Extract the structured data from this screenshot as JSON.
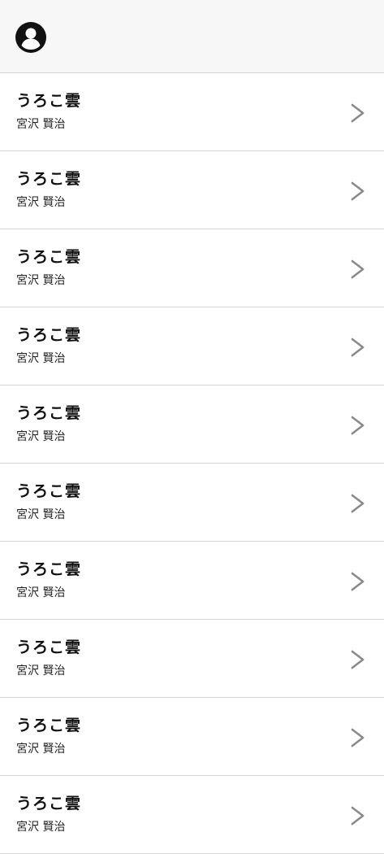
{
  "header": {
    "avatar_icon": "account-circle-icon",
    "colors": {
      "background": "#f7f7f7",
      "icon": "#111111"
    }
  },
  "list": {
    "chevron_icon": "chevron-right-icon",
    "chevron_color": "#8a8a8a",
    "divider_color": "#d6d6d6",
    "items": [
      {
        "title": "うろこ雲",
        "author": "宮沢 賢治"
      },
      {
        "title": "うろこ雲",
        "author": "宮沢 賢治"
      },
      {
        "title": "うろこ雲",
        "author": "宮沢 賢治"
      },
      {
        "title": "うろこ雲",
        "author": "宮沢 賢治"
      },
      {
        "title": "うろこ雲",
        "author": "宮沢 賢治"
      },
      {
        "title": "うろこ雲",
        "author": "宮沢 賢治"
      },
      {
        "title": "うろこ雲",
        "author": "宮沢 賢治"
      },
      {
        "title": "うろこ雲",
        "author": "宮沢 賢治"
      },
      {
        "title": "うろこ雲",
        "author": "宮沢 賢治"
      },
      {
        "title": "うろこ雲",
        "author": "宮沢 賢治"
      }
    ]
  }
}
